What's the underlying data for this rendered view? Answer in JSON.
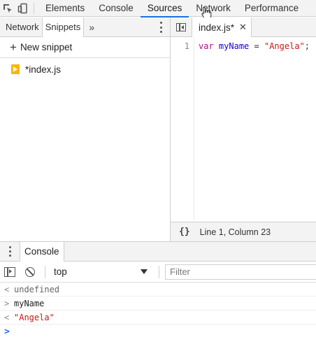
{
  "main_tabs": [
    {
      "label": "Elements"
    },
    {
      "label": "Console"
    },
    {
      "label": "Sources",
      "active": true
    },
    {
      "label": "Network"
    },
    {
      "label": "Performance"
    }
  ],
  "navigator": {
    "tabs": [
      {
        "label": "Network"
      },
      {
        "label": "Snippets",
        "active": true
      }
    ],
    "more_icon": "chevron-double-right-icon",
    "new_snippet_label": "New snippet",
    "snippets": [
      {
        "name": "*index.js"
      }
    ]
  },
  "editor": {
    "tab_label": "index.js*",
    "lines": [
      {
        "number": "1",
        "keyword": "var",
        "identifier": "myName",
        "operator": "=",
        "string": "\"Angela\"",
        "terminator": ";"
      }
    ],
    "status": "Line 1, Column 23",
    "pretty_print_label": "{}"
  },
  "drawer": {
    "tab_label": "Console",
    "context": "top",
    "filter_placeholder": "Filter",
    "messages": [
      {
        "glyph": "<",
        "text": "undefined",
        "kind": "result"
      },
      {
        "glyph": ">",
        "text": "myName",
        "kind": "input"
      },
      {
        "glyph": "<",
        "text": "\"Angela\"",
        "kind": "result-string"
      }
    ],
    "prompt_glyph": ">"
  },
  "colors": {
    "accent": "#1a73e8",
    "keyword": "#aa0d91",
    "identifier": "#1c00cf",
    "string": "#c41a16",
    "snippet_icon": "#f9b701"
  }
}
